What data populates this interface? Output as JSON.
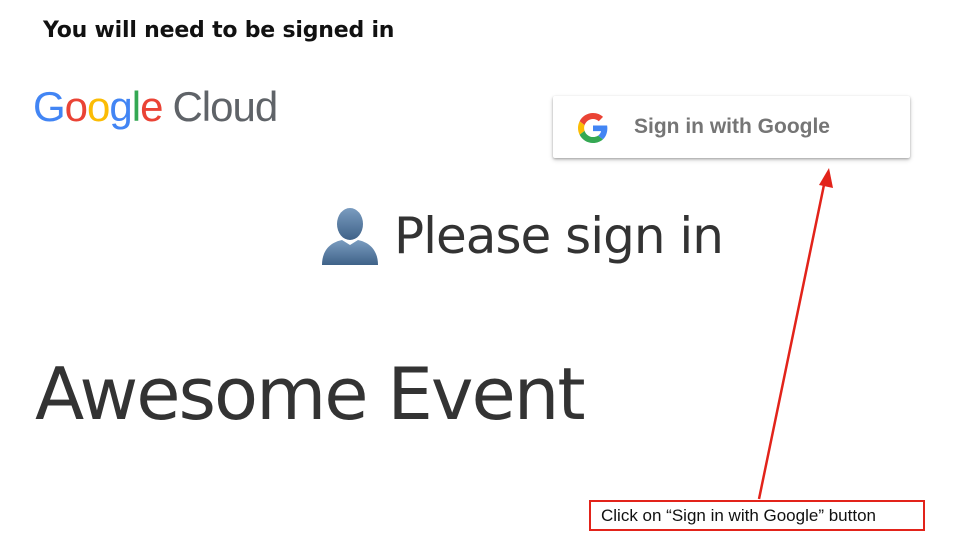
{
  "slide": {
    "title": "You will need to be signed in"
  },
  "logo": {
    "letters": [
      "G",
      "o",
      "o",
      "g",
      "l",
      "e"
    ],
    "product": "Cloud",
    "colors": {
      "blue": "#4285F4",
      "red": "#EA4335",
      "yellow": "#FBBC05",
      "green": "#34A853",
      "grey": "#5f6368"
    }
  },
  "signin_button": {
    "label": "Sign in with Google",
    "icon": "google-g-icon"
  },
  "prompt": {
    "icon": "person-silhouette-icon",
    "text": "Please sign in"
  },
  "event": {
    "title": "Awesome Event"
  },
  "callout": {
    "text": "Click on “Sign in with Google” button",
    "border_color": "#e2231a"
  }
}
